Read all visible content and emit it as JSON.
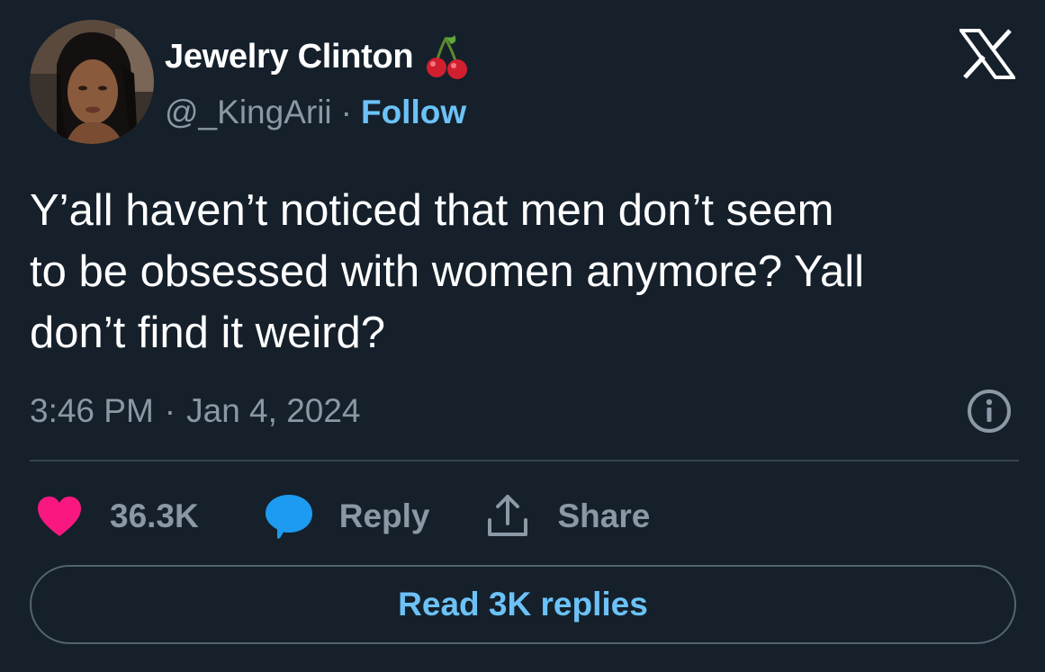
{
  "author": {
    "display_name": "Jewelry Clinton",
    "name_emoji_icon": "cherry-icon",
    "handle": "@_KingArii",
    "separator": "·",
    "follow_label": "Follow",
    "avatar_icon": "profile-photo"
  },
  "brand": {
    "logo_icon": "x-logo-icon"
  },
  "tweet": {
    "lines": [
      "Y’all haven’t noticed that men don’t seem",
      "to be obsessed with women anymore? Yall",
      "don’t find it weird?"
    ],
    "time": "3:46 PM",
    "separator": "·",
    "date": "Jan 4, 2024"
  },
  "actions": {
    "like_count": "36.3K",
    "like_icon": "heart-icon",
    "reply_label": "Reply",
    "reply_icon": "speech-bubble-icon",
    "share_label": "Share",
    "share_icon": "share-upload-icon",
    "info_icon": "info-icon"
  },
  "footer": {
    "read_replies_label": "Read 3K replies"
  },
  "colors": {
    "background": "#15202b",
    "text_primary": "#ffffff",
    "text_secondary": "#8b98a5",
    "link": "#6cc2f7",
    "heart": "#f91880",
    "reply_bubble": "#1d9bf0",
    "divider": "#38444d",
    "button_border": "#536471"
  }
}
